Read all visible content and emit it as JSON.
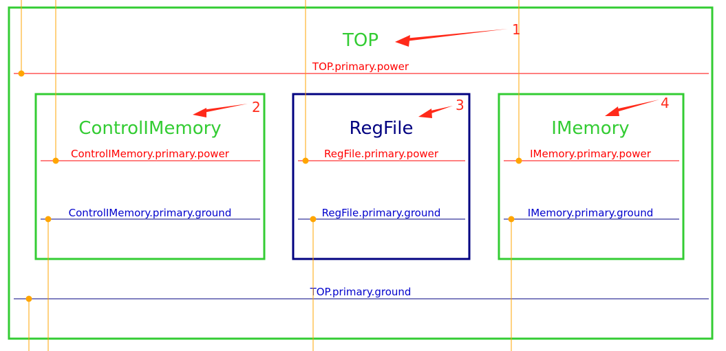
{
  "colors": {
    "active_block": "#33cc33",
    "selected_block": "#000080",
    "power_net": "#ff0000",
    "ground_net": "#0000cc",
    "connector": "#ffa500",
    "annotation": "#ff2a1a"
  },
  "top": {
    "title": "TOP",
    "power_label": "TOP.primary.power",
    "ground_label": "TOP.primary.ground"
  },
  "blocks": [
    {
      "name": "ControlIMemory",
      "power_label": "ControlIMemory.primary.power",
      "ground_label": "ControlIMemory.primary.ground",
      "selected": false
    },
    {
      "name": "RegFile",
      "power_label": "RegFile.primary.power",
      "ground_label": "RegFile.primary.ground",
      "selected": true
    },
    {
      "name": "IMemory",
      "power_label": "IMemory.primary.power",
      "ground_label": "IMemory.primary.ground",
      "selected": false
    }
  ],
  "annotations": [
    "1",
    "2",
    "3",
    "4"
  ]
}
